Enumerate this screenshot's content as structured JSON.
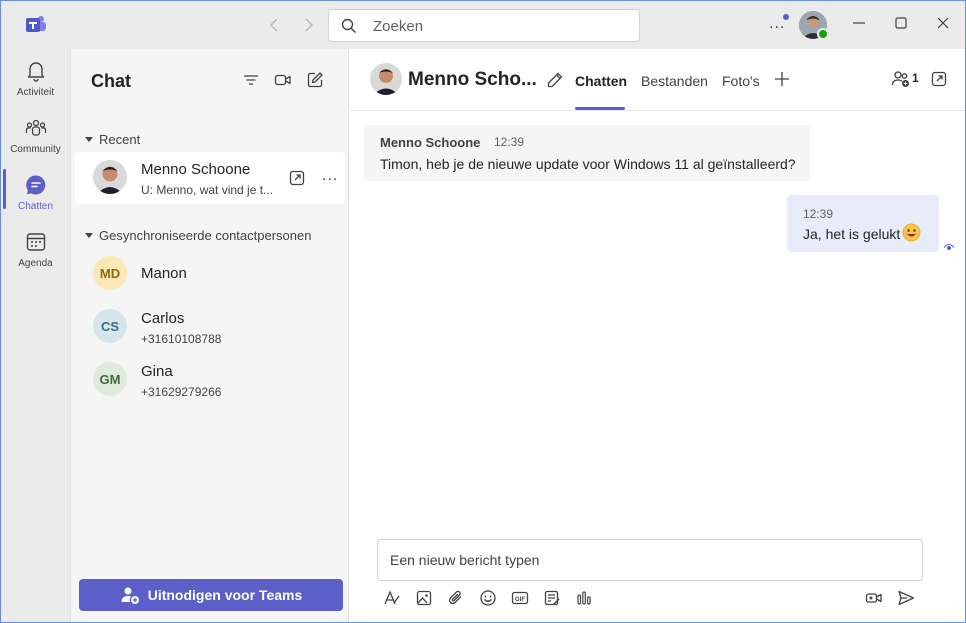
{
  "titlebar": {
    "search_placeholder": "Zoeken",
    "more": "..."
  },
  "rail": {
    "items": [
      {
        "label": "Activiteit",
        "icon": "bell-icon"
      },
      {
        "label": "Community",
        "icon": "people-community-icon"
      },
      {
        "label": "Chatten",
        "icon": "chat-icon",
        "active": true
      },
      {
        "label": "Agenda",
        "icon": "calendar-icon"
      }
    ]
  },
  "chatlist": {
    "title": "Chat",
    "recent_label": "Recent",
    "synced_label": "Gesynchroniseerde contactpersonen",
    "recent": [
      {
        "name": "Menno Schoone",
        "preview": "U: Menno, wat vind je t...",
        "more": "..."
      }
    ],
    "contacts": [
      {
        "initials": "MD",
        "name": "Manon",
        "phone": ""
      },
      {
        "initials": "CS",
        "name": "Carlos",
        "phone": "+31610108788"
      },
      {
        "initials": "GM",
        "name": "Gina",
        "phone": "+31629279266"
      }
    ],
    "invite_label": "Uitnodigen voor Teams"
  },
  "conversation": {
    "name": "Menno Scho...",
    "tabs": [
      {
        "label": "Chatten",
        "active": true
      },
      {
        "label": "Bestanden"
      },
      {
        "label": "Foto's"
      }
    ],
    "participants_count": "1",
    "messages": [
      {
        "sender": "Menno Schoone",
        "time": "12:39",
        "text": "Timon, heb je de nieuwe update voor Windows 11 al geïnstalleerd?"
      },
      {
        "time": "12:39",
        "text": "Ja, het is gelukt"
      }
    ],
    "compose_placeholder": "Een nieuw bericht typen"
  },
  "colors": {
    "accent": "#5b5fc7",
    "rail_bg": "#ebebeb",
    "list_bg": "#f5f5f5",
    "outgoing_bubble": "#e8ebfa",
    "presence": "#13a10e"
  }
}
